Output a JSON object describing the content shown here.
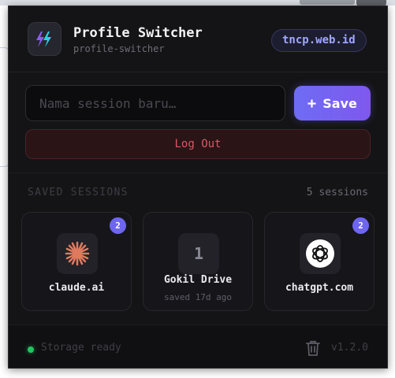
{
  "header": {
    "title": "Profile Switcher",
    "subtitle": "profile-switcher",
    "domain": "tncp.web.id",
    "logo_icon": "double-lightning-icon"
  },
  "form": {
    "session_placeholder": "Nama session baru…",
    "session_value": "",
    "save_label": "Save",
    "save_icon": "plus-icon",
    "logout_label": "Log Out"
  },
  "sessions": {
    "section_label": "SAVED SESSIONS",
    "count_label": "5 sessions",
    "cards": [
      {
        "name": "claude.ai",
        "badge": "2",
        "meta": "",
        "icon": "claude-sunburst-icon"
      },
      {
        "name": "Gokil Drive",
        "badge": "",
        "meta": "saved 17d ago",
        "icon_text": "1"
      },
      {
        "name": "chatgpt.com",
        "badge": "2",
        "meta": "",
        "icon": "openai-icon"
      }
    ]
  },
  "footer": {
    "status": "Storage ready",
    "version": "v1.2.0",
    "status_color": "#22c55e"
  },
  "colors": {
    "accent": "#6e66f0",
    "danger": "#d65a64",
    "background": "#141416"
  }
}
